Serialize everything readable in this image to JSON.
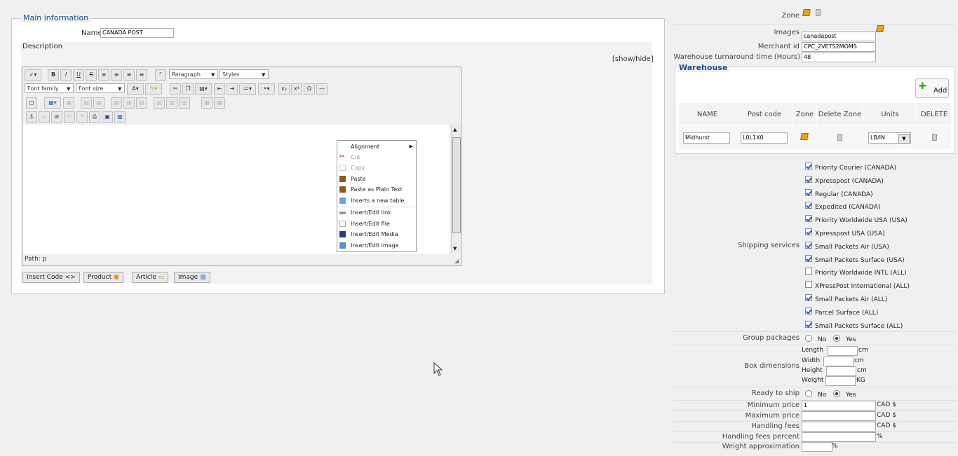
{
  "main": {
    "legend": "Main information",
    "name_label": "Name",
    "name_value": "CANADA POST",
    "description_label": "Description",
    "show_hide": "[show/hide]",
    "editor": {
      "format_select": "Paragraph",
      "styles_select": "Styles",
      "font_family_select": "Font family",
      "font_size_select": "Font size",
      "path": "Path: p"
    },
    "context_menu": [
      "Alignment",
      "Cut",
      "Copy",
      "Paste",
      "Paste as Plain Text",
      "Inserts a new table",
      "Insert/Edit link",
      "Insert/Edit file",
      "Insert/Edit Media",
      "Insert/Edit image"
    ],
    "insert_buttons": [
      "Insert Code",
      "Product",
      "Article",
      "Image"
    ]
  },
  "right": {
    "zone_label": "Zone",
    "images_label": "Images",
    "images_value": "canadapost",
    "merchant_label": "Merchant id",
    "merchant_value": "CPC_2VETS2MOMS",
    "turnaround_label": "Warehouse turnaround time (Hours)",
    "turnaround_value": "48",
    "warehouse": {
      "title": "Warehouse",
      "add_label": "Add",
      "headers": [
        "NAME",
        "Post code",
        "Zone",
        "Delete Zone",
        "Units",
        "DELETE"
      ],
      "row": {
        "name": "Midhurst",
        "post_code": "L0L1X0",
        "units": "LB/IN"
      }
    },
    "shipping_label": "Shipping services",
    "shipping_services": [
      {
        "label": "Priority Courier (CANADA)",
        "checked": true
      },
      {
        "label": "Xpresspost (CANADA)",
        "checked": true
      },
      {
        "label": "Regular (CANADA)",
        "checked": true
      },
      {
        "label": "Expedited (CANADA)",
        "checked": true
      },
      {
        "label": "Priority Worldwide USA (USA)",
        "checked": true
      },
      {
        "label": "Xpresspost USA (USA)",
        "checked": true
      },
      {
        "label": "Small Packets Air (USA)",
        "checked": true
      },
      {
        "label": "Small Packets Surface (USA)",
        "checked": true
      },
      {
        "label": "Priority Worldwide INTL (ALL)",
        "checked": false
      },
      {
        "label": "XPressPost International (ALL)",
        "checked": false
      },
      {
        "label": "Small Packets Air (ALL)",
        "checked": true
      },
      {
        "label": "Parcel Surface (ALL)",
        "checked": true
      },
      {
        "label": "Small Packets Surface (ALL)",
        "checked": true
      }
    ],
    "group_packages_label": "Group packages",
    "no_label": "No",
    "yes_label": "Yes",
    "box_dimensions_label": "Box dimensions",
    "box": {
      "length": "Length",
      "width": "Width",
      "height": "Height",
      "weight": "Weight",
      "cm": "cm",
      "kg": "KG"
    },
    "ready_label": "Ready to ship",
    "min_price_label": "Minimum price",
    "min_price_value": "1",
    "max_price_label": "Maximum price",
    "handling_fees_label": "Handling fees",
    "handling_pct_label": "Handling fees percent",
    "weight_approx_label": "Weight approximation",
    "currency": "CAD $",
    "percent": "%"
  }
}
